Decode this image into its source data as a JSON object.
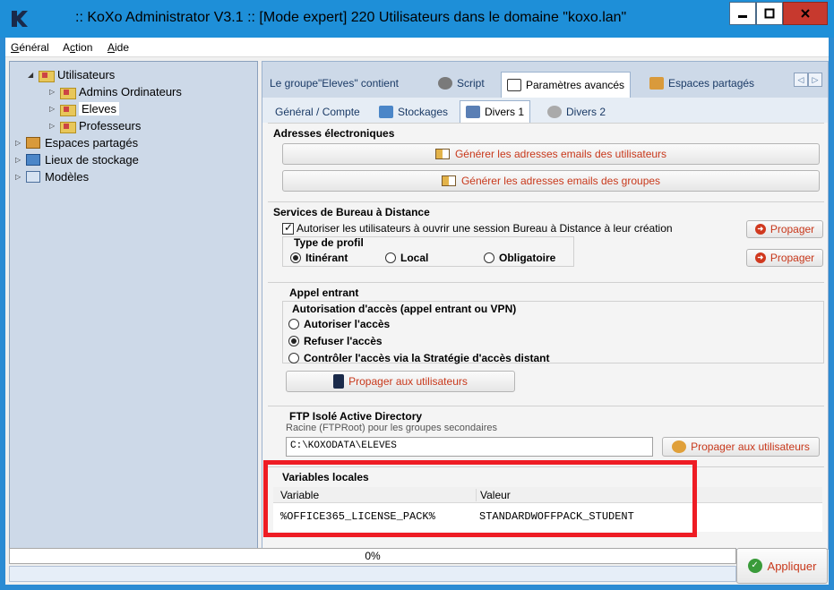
{
  "window": {
    "title": ":: KoXo Administrator V3.1 :: [Mode expert] 220 Utilisateurs dans le domaine \"koxo.lan\"",
    "minimize_glyph": "▁",
    "maximize_glyph": "▢",
    "close_glyph": "x",
    "logo_icon": "koxo-logo-icon"
  },
  "menu": {
    "items": [
      {
        "pre": "",
        "u": "G",
        "post": "énéral"
      },
      {
        "pre": "A",
        "u": "c",
        "post": "tion"
      },
      {
        "pre": "",
        "u": "A",
        "post": "ide"
      }
    ]
  },
  "tree": {
    "items": [
      {
        "label": "Utilisateurs",
        "icon": "folder-icon",
        "expanded": true
      },
      {
        "label": "Admins Ordinateurs",
        "icon": "folder-icon"
      },
      {
        "label": "Eleves",
        "icon": "folder-icon",
        "selected": true
      },
      {
        "label": "Professeurs",
        "icon": "folder-icon"
      },
      {
        "label": "Espaces partagés",
        "icon": "share-icon"
      },
      {
        "label": "Lieux de stockage",
        "icon": "storage-icon"
      },
      {
        "label": "Modèles",
        "icon": "template-icon"
      }
    ]
  },
  "tabs": {
    "group_contains": "Le groupe\"Eleves\" contient",
    "script": "Script",
    "advanced": "Paramètres avancés",
    "shared": "Espaces partagés"
  },
  "subtabs": {
    "general": "Général / Compte",
    "storage": "Stockages",
    "misc1": "Divers 1",
    "misc2": "Divers 2"
  },
  "email": {
    "title": "Adresses électroniques",
    "users_button": "Générer les adresses emails des utilisateurs",
    "groups_button": "Générer les adresses emails des groupes"
  },
  "rds": {
    "title": "Services de Bureau à Distance",
    "allow_label": "Autoriser les utilisateurs à ouvrir une session Bureau à Distance à leur création",
    "allow_checked": true,
    "propagate_label": "Propager",
    "profile_title": "Type de profil",
    "profile_options": [
      "Itinérant",
      "Local",
      "Obligatoire"
    ],
    "profile_selected": "Itinérant"
  },
  "dialin": {
    "title": "Appel entrant",
    "subtitle": "Autorisation d'accès (appel entrant ou VPN)",
    "options": [
      "Autoriser l'accès",
      "Refuser l'accès",
      "Contrôler l'accès via la Stratégie d'accès distant"
    ],
    "selected": "Refuser l'accès",
    "propagate_button": "Propager aux utilisateurs"
  },
  "ftp": {
    "title": "FTP Isolé Active Directory",
    "root_label": "Racine (FTPRoot) pour les groupes secondaires",
    "root_value": "C:\\KOXODATA\\ELEVES",
    "propagate_button": "Propager aux utilisateurs"
  },
  "vars": {
    "title": "Variables locales",
    "col_variable": "Variable",
    "col_value": "Valeur",
    "rows": [
      {
        "variable": "%OFFICE365_LICENSE_PACK%",
        "value": "STANDARDWOFFPACK_STUDENT"
      }
    ]
  },
  "status": {
    "progress_text": "0%",
    "progress": 0,
    "apply_label": "Appliquer"
  },
  "colors": {
    "titlebar": "#1e8fd8",
    "accent_red": "#c8381b",
    "highlight": "#ee1c24",
    "tree_bg": "#cdd9e8"
  }
}
